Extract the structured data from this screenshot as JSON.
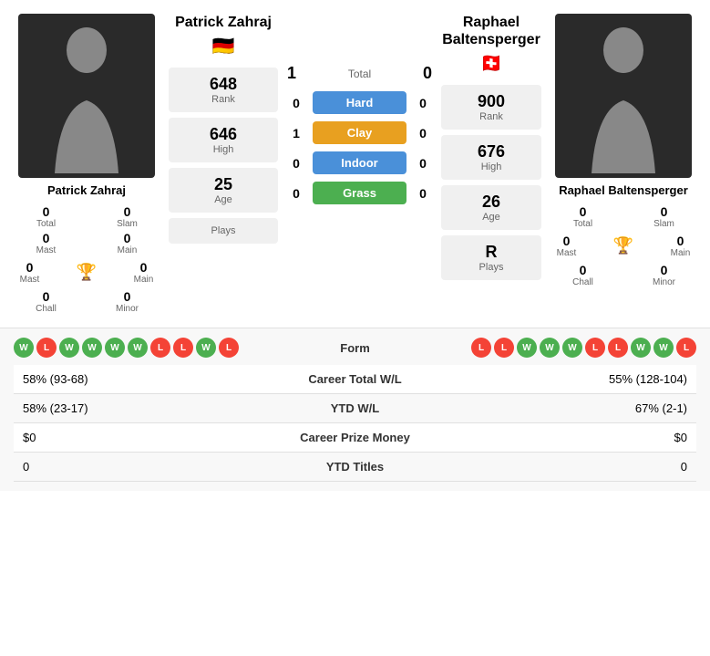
{
  "player1": {
    "name": "Patrick Zahraj",
    "flag": "🇩🇪",
    "rank_value": "648",
    "rank_label": "Rank",
    "high_value": "646",
    "high_label": "High",
    "age_value": "25",
    "age_label": "Age",
    "plays_value": "",
    "plays_label": "Plays",
    "total_value": "0",
    "total_label": "Total",
    "slam_value": "0",
    "slam_label": "Slam",
    "mast_value": "0",
    "mast_label": "Mast",
    "main_value": "0",
    "main_label": "Main",
    "chall_value": "0",
    "chall_label": "Chall",
    "minor_value": "0",
    "minor_label": "Minor"
  },
  "player2": {
    "name": "Raphael Baltensperger",
    "flag": "🇨🇭",
    "rank_value": "900",
    "rank_label": "Rank",
    "high_value": "676",
    "high_label": "High",
    "age_value": "26",
    "age_label": "Age",
    "plays_value": "R",
    "plays_label": "Plays",
    "total_value": "0",
    "total_label": "Total",
    "slam_value": "0",
    "slam_label": "Slam",
    "mast_value": "0",
    "mast_label": "Mast",
    "main_value": "0",
    "main_label": "Main",
    "chall_value": "0",
    "chall_label": "Chall",
    "minor_value": "0",
    "minor_label": "Minor"
  },
  "match": {
    "score1": "1",
    "score2": "0",
    "total_label": "Total",
    "hard_label": "Hard",
    "hard_score1": "0",
    "hard_score2": "0",
    "clay_label": "Clay",
    "clay_score1": "1",
    "clay_score2": "0",
    "indoor_label": "Indoor",
    "indoor_score1": "0",
    "indoor_score2": "0",
    "grass_label": "Grass",
    "grass_score1": "0",
    "grass_score2": "0"
  },
  "form": {
    "label": "Form",
    "player1_form": [
      "W",
      "L",
      "W",
      "W",
      "W",
      "W",
      "L",
      "L",
      "W",
      "L"
    ],
    "player2_form": [
      "L",
      "L",
      "W",
      "W",
      "W",
      "L",
      "L",
      "W",
      "W",
      "L"
    ]
  },
  "stats": [
    {
      "left": "58% (93-68)",
      "center": "Career Total W/L",
      "right": "55% (128-104)"
    },
    {
      "left": "58% (23-17)",
      "center": "YTD W/L",
      "right": "67% (2-1)"
    },
    {
      "left": "$0",
      "center": "Career Prize Money",
      "right": "$0"
    },
    {
      "left": "0",
      "center": "YTD Titles",
      "right": "0"
    }
  ]
}
